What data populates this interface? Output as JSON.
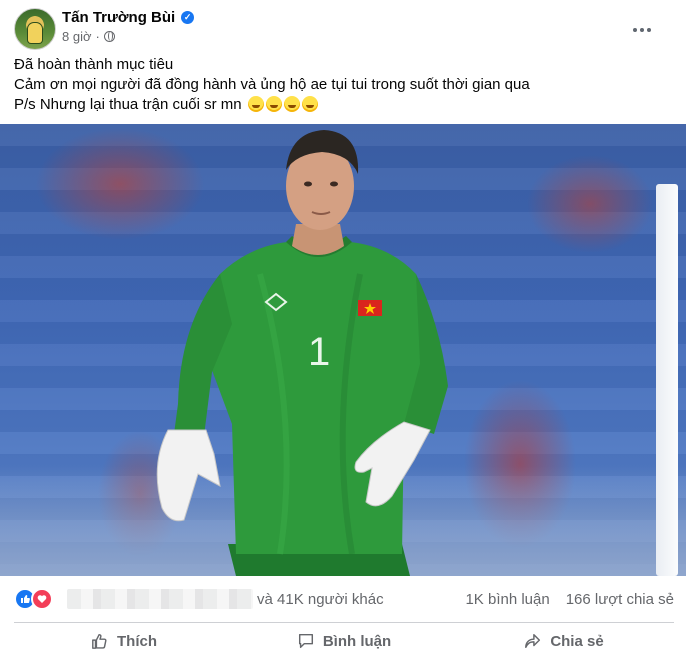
{
  "post": {
    "author": "Tấn Trường Bùi",
    "verified_mark": "✓",
    "time": "8 giờ",
    "separator": "·",
    "lines": [
      "Đã hoàn thành mục tiêu",
      "Cảm ơn mọi người đã đồng hành và ủng hộ ae tụi tui trong suốt thời gian qua",
      "P/s Nhưng lại thua trận cuối sr mn"
    ],
    "emoji_count": 4
  },
  "photo": {
    "jersey_number": "1"
  },
  "reactions": {
    "icons": [
      "like-icon",
      "love-icon"
    ],
    "summary": "và 41K người khác",
    "comments": "1K bình luận",
    "shares": "166 lượt chia sẻ"
  },
  "actions": {
    "like": "Thích",
    "comment": "Bình luận",
    "share": "Chia sẻ"
  },
  "colors": {
    "accent": "#1877f2",
    "love": "#f33e58",
    "secondary_text": "#65676b",
    "jersey": "#2e9a3c"
  }
}
